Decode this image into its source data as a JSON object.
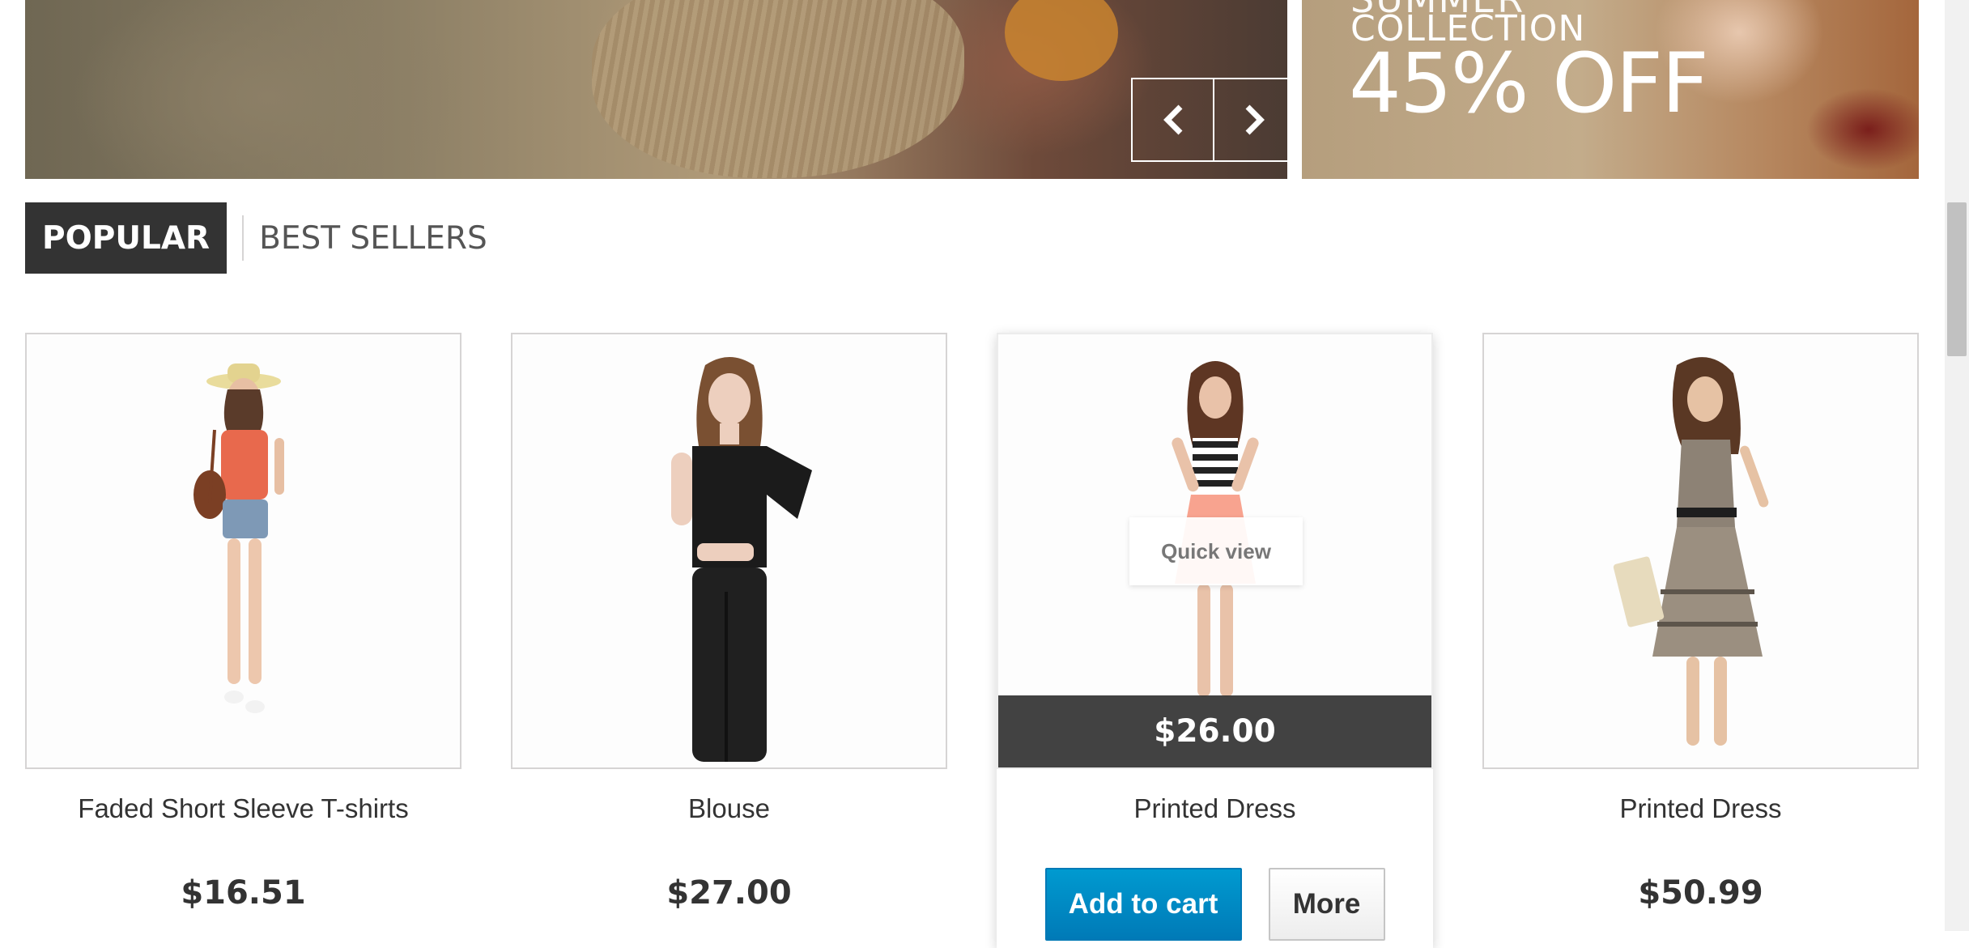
{
  "banner": {
    "prev_icon": "chevron-left-icon",
    "next_icon": "chevron-right-icon",
    "side_promo": {
      "line1": "SUMMER",
      "line2": "COLLECTION",
      "discount": "45% OFF"
    }
  },
  "tabs": [
    {
      "label": "POPULAR",
      "active": true
    },
    {
      "label": "BEST SELLERS",
      "active": false
    }
  ],
  "products": [
    {
      "name": "Faded Short Sleeve T-shirts",
      "price": "$16.51"
    },
    {
      "name": "Blouse",
      "price": "$27.00"
    },
    {
      "name": "Printed Dress",
      "price": "$26.00",
      "hovered": true,
      "quick_view_label": "Quick view",
      "add_to_cart_label": "Add to cart",
      "more_label": "More"
    },
    {
      "name": "Printed Dress",
      "price": "$50.99"
    }
  ],
  "colors": {
    "accent_blue": "#0083c5",
    "tab_active_bg": "#333333",
    "price_bar_bg": "#323232"
  }
}
